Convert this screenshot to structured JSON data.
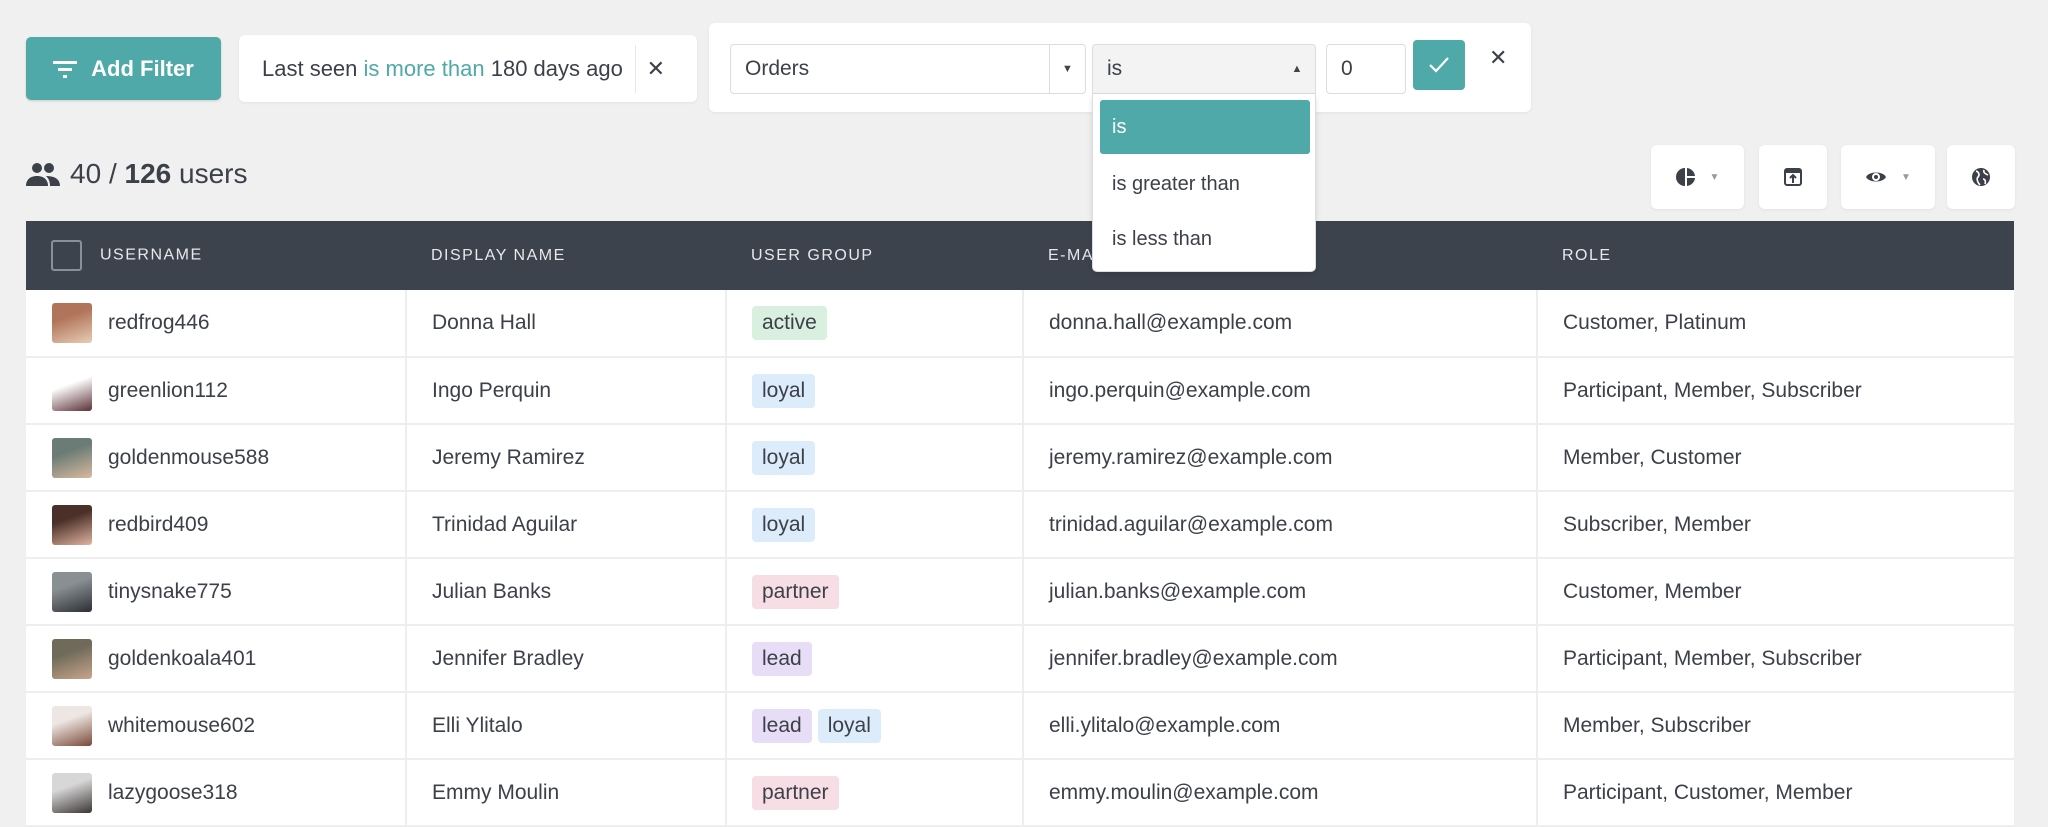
{
  "toolbar": {
    "add_filter": "Add Filter"
  },
  "active_filter": {
    "field": "Last seen",
    "operator": "is more than",
    "value": "180 days ago"
  },
  "filter_editor": {
    "field": "Orders",
    "operator": "is",
    "value": "0",
    "operator_options": [
      "is",
      "is greater than",
      "is less than"
    ]
  },
  "count": {
    "shown": "40",
    "separator": "/",
    "total": "126",
    "unit": "users"
  },
  "colors": {
    "accent": "#4ea9a8",
    "header": "#3d434d",
    "active": "#d9efe0",
    "loyal": "#dcecfa",
    "partner": "#f7dde4",
    "lead": "#e8ddf6"
  },
  "table": {
    "headers": [
      "USERNAME",
      "DISPLAY NAME",
      "USER GROUP",
      "E-MAIL",
      "ROLE"
    ],
    "rows": [
      {
        "username": "redfrog446",
        "name": "Donna Hall",
        "groups": [
          "active"
        ],
        "email": "donna.hall@example.com",
        "role": "Customer, Platinum"
      },
      {
        "username": "greenlion112",
        "name": "Ingo Perquin",
        "groups": [
          "loyal"
        ],
        "email": "ingo.perquin@example.com",
        "role": "Participant, Member, Subscriber"
      },
      {
        "username": "goldenmouse588",
        "name": "Jeremy Ramirez",
        "groups": [
          "loyal"
        ],
        "email": "jeremy.ramirez@example.com",
        "role": "Member, Customer"
      },
      {
        "username": "redbird409",
        "name": "Trinidad Aguilar",
        "groups": [
          "loyal"
        ],
        "email": "trinidad.aguilar@example.com",
        "role": "Subscriber, Member"
      },
      {
        "username": "tinysnake775",
        "name": "Julian Banks",
        "groups": [
          "partner"
        ],
        "email": "julian.banks@example.com",
        "role": "Customer, Member"
      },
      {
        "username": "goldenkoala401",
        "name": "Jennifer Bradley",
        "groups": [
          "lead"
        ],
        "email": "jennifer.bradley@example.com",
        "role": "Participant, Member, Subscriber"
      },
      {
        "username": "whitemouse602",
        "name": "Elli Ylitalo",
        "groups": [
          "lead",
          "loyal"
        ],
        "email": "elli.ylitalo@example.com",
        "role": "Member, Subscriber"
      },
      {
        "username": "lazygoose318",
        "name": "Emmy Moulin",
        "groups": [
          "partner"
        ],
        "email": "emmy.moulin@example.com",
        "role": "Participant, Customer, Member"
      }
    ]
  }
}
